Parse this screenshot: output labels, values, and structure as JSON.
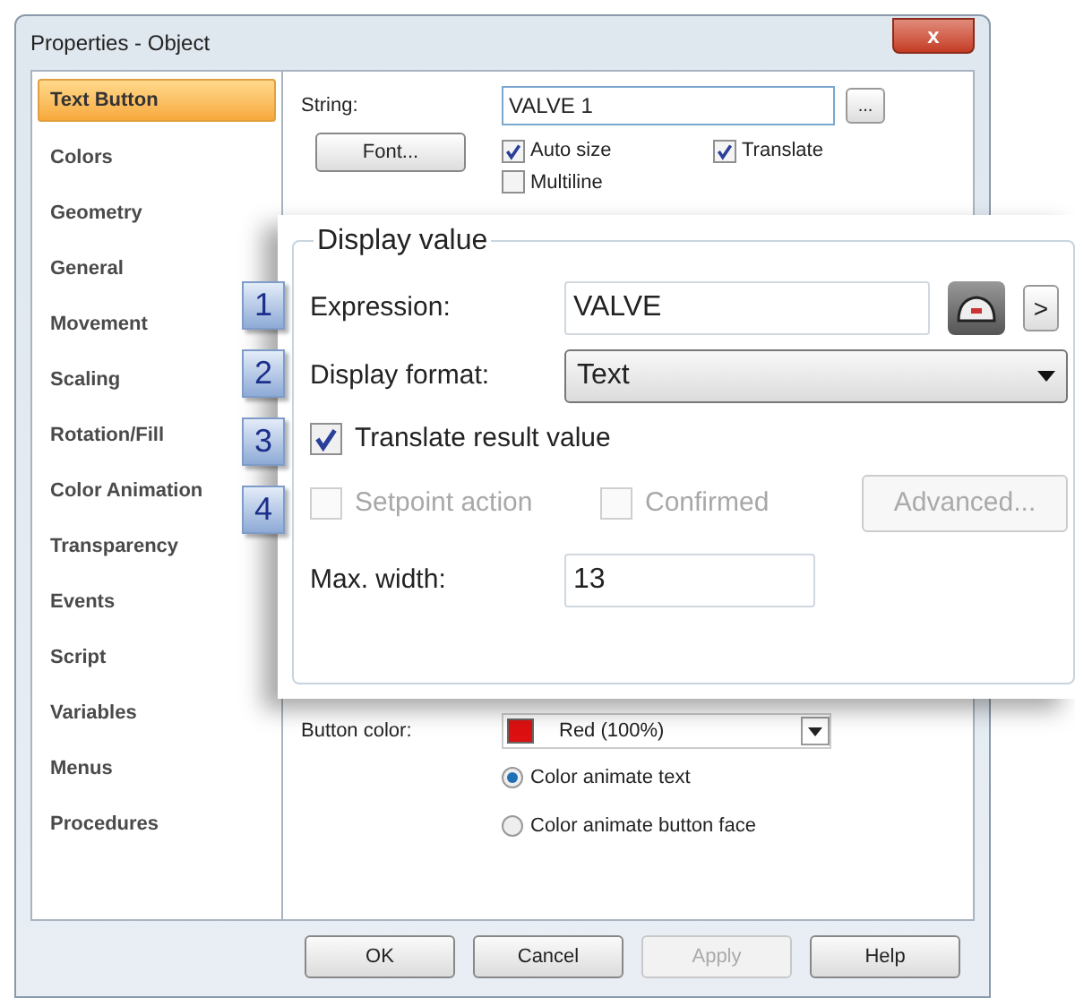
{
  "window": {
    "title": "Properties - Object",
    "close_label": "x"
  },
  "sidebar": {
    "items": [
      {
        "label": "Text Button",
        "selected": true
      },
      {
        "label": "Colors",
        "selected": false
      },
      {
        "label": "Geometry",
        "selected": false
      },
      {
        "label": "General",
        "selected": false
      },
      {
        "label": "Movement",
        "selected": false
      },
      {
        "label": "Scaling",
        "selected": false
      },
      {
        "label": "Rotation/Fill",
        "selected": false
      },
      {
        "label": "Color Animation",
        "selected": false
      },
      {
        "label": "Transparency",
        "selected": false
      },
      {
        "label": "Events",
        "selected": false
      },
      {
        "label": "Script",
        "selected": false
      },
      {
        "label": "Variables",
        "selected": false
      },
      {
        "label": "Menus",
        "selected": false
      },
      {
        "label": "Procedures",
        "selected": false
      }
    ]
  },
  "content": {
    "string_label": "String:",
    "string_value": "VALVE 1",
    "browse_button": "...",
    "font_button": "Font...",
    "checkboxes": [
      {
        "label": "Auto size",
        "checked": true
      },
      {
        "label": "Translate",
        "checked": true
      },
      {
        "label": "Multiline",
        "checked": false
      }
    ],
    "button_color_label": "Button color:",
    "button_color_value": "Red (100%)",
    "radios": [
      {
        "label": "Color animate text",
        "selected": true
      },
      {
        "label": "Color animate button face",
        "selected": false
      }
    ]
  },
  "display_value": {
    "title": "Display value",
    "expression_label": "Expression:",
    "expression_value": "VALVE",
    "expand_button": ">",
    "display_format_label": "Display format:",
    "display_format_value": "Text",
    "translate_result": {
      "label": "Translate result value",
      "checked": true
    },
    "setpoint_action": {
      "label": "Setpoint action",
      "checked": false,
      "disabled": true
    },
    "confirmed": {
      "label": "Confirmed",
      "checked": false,
      "disabled": true
    },
    "advanced_button": {
      "label": "Advanced...",
      "disabled": true
    },
    "max_width_label": "Max. width:",
    "max_width_value": "13",
    "markers": [
      "1",
      "2",
      "3",
      "4"
    ]
  },
  "buttons": [
    {
      "label": "OK",
      "disabled": false
    },
    {
      "label": "Cancel",
      "disabled": false
    },
    {
      "label": "Apply",
      "disabled": true
    },
    {
      "label": "Help",
      "disabled": false
    }
  ]
}
